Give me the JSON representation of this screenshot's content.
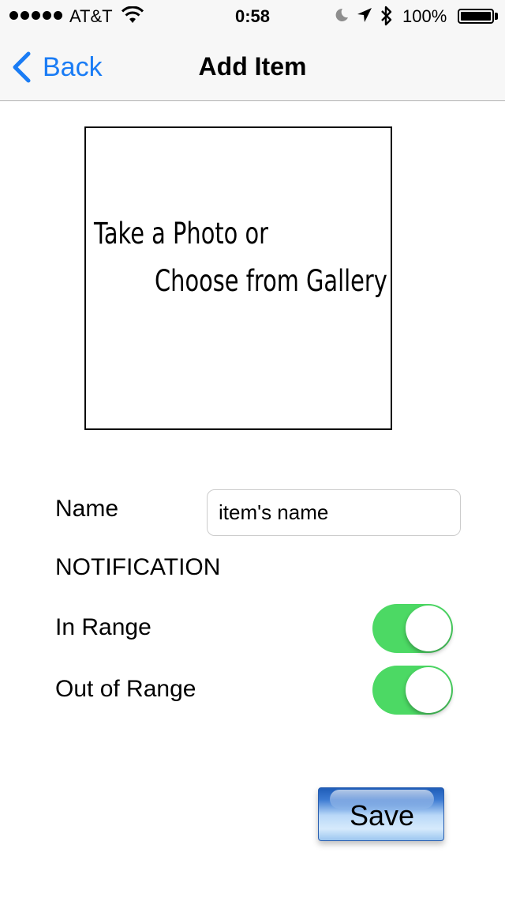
{
  "status_bar": {
    "carrier": "AT&T",
    "time": "0:58",
    "battery_percent": "100%",
    "battery_level": 1.0,
    "icons": [
      "signal-dots",
      "wifi-icon",
      "moon-icon",
      "location-arrow-icon",
      "bluetooth-icon",
      "battery-icon"
    ]
  },
  "nav": {
    "back_label": "Back",
    "title": "Add Item"
  },
  "photo": {
    "line1": "Take a Photo or",
    "line2": "Choose from Gallery"
  },
  "form": {
    "name_label": "Name",
    "name_placeholder": "item's name",
    "notification_heading": "NOTIFICATION",
    "in_range_label": "In Range",
    "in_range_on": true,
    "out_of_range_label": "Out of Range",
    "out_of_range_on": true
  },
  "save_label": "Save",
  "colors": {
    "accent": "#1a7cf5",
    "toggle_on": "#4cd964"
  }
}
